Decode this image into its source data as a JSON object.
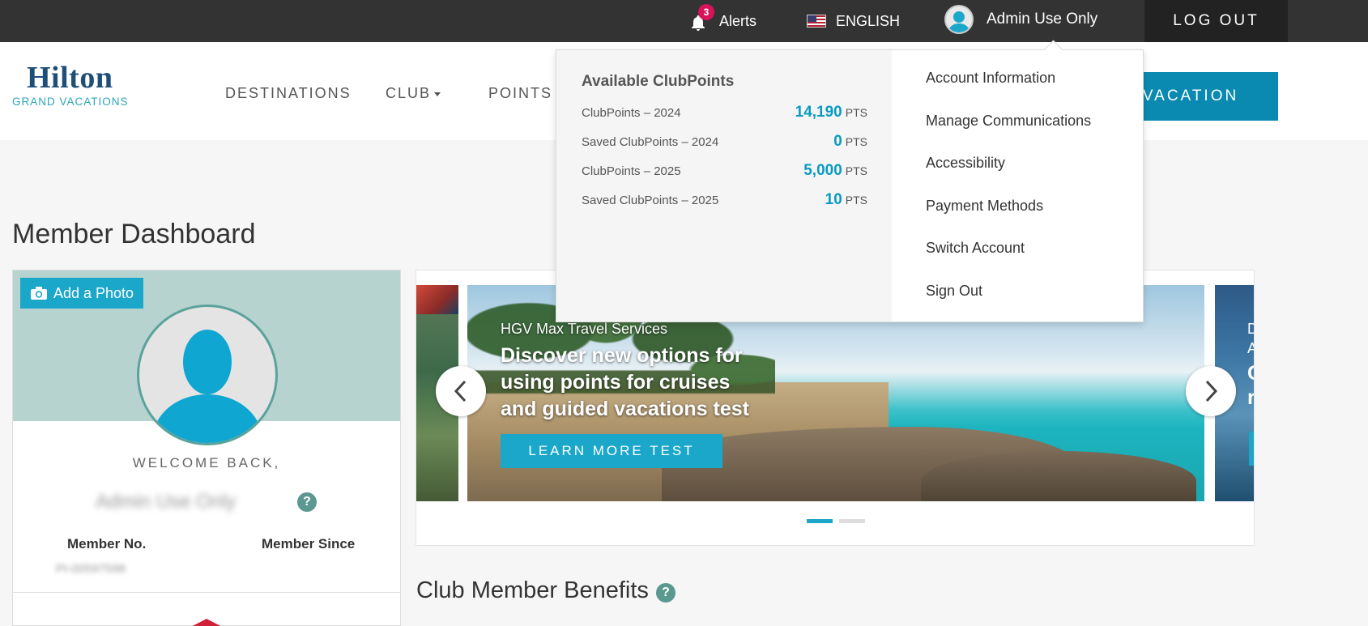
{
  "topbar": {
    "alerts_label": "Alerts",
    "alerts_count": "3",
    "language": "ENGLISH",
    "user_name": "Admin Use Only",
    "logout_label": "LOG OUT"
  },
  "brand": {
    "logo_main": "Hilton",
    "logo_sub": "GRAND VACATIONS"
  },
  "nav": {
    "destinations": "DESTINATIONS",
    "club": "CLUB",
    "points": "POINTS I",
    "book_vacation": "A VACATION"
  },
  "page": {
    "title": "Member Dashboard",
    "benefits_title": "Club Member Benefits"
  },
  "profile": {
    "add_photo": "Add a Photo",
    "welcome": "WELCOME BACK,",
    "name": "Admin Use Only",
    "member_no_label": "Member No.",
    "member_since_label": "Member Since",
    "member_no_value": "PI-00597598",
    "help": "?"
  },
  "carousel": {
    "kicker": "HGV Max Travel Services",
    "headline": "Discover new options for using points for cruises and guided vacations test",
    "button": "LEARN MORE TEST",
    "next_kicker": "D\nA",
    "next_headline": "C\nr",
    "slides": 2,
    "active_slide": 1
  },
  "dropdown": {
    "heading": "Available ClubPoints",
    "points": [
      {
        "label": "ClubPoints – 2024",
        "value": "14,190",
        "unit": "PTS"
      },
      {
        "label": "Saved ClubPoints – 2024",
        "value": "0",
        "unit": "PTS"
      },
      {
        "label": "ClubPoints – 2025",
        "value": "5,000",
        "unit": "PTS"
      },
      {
        "label": "Saved ClubPoints – 2025",
        "value": "10",
        "unit": "PTS"
      }
    ],
    "menu": [
      "Account Information",
      "Manage Communications",
      "Accessibility",
      "Payment Methods",
      "Switch Account",
      "Sign Out"
    ]
  },
  "colors": {
    "topbar": "#333333",
    "accent": "#1ba7c9",
    "brand_navy": "#1f4e79",
    "badge": "#d8135a"
  }
}
